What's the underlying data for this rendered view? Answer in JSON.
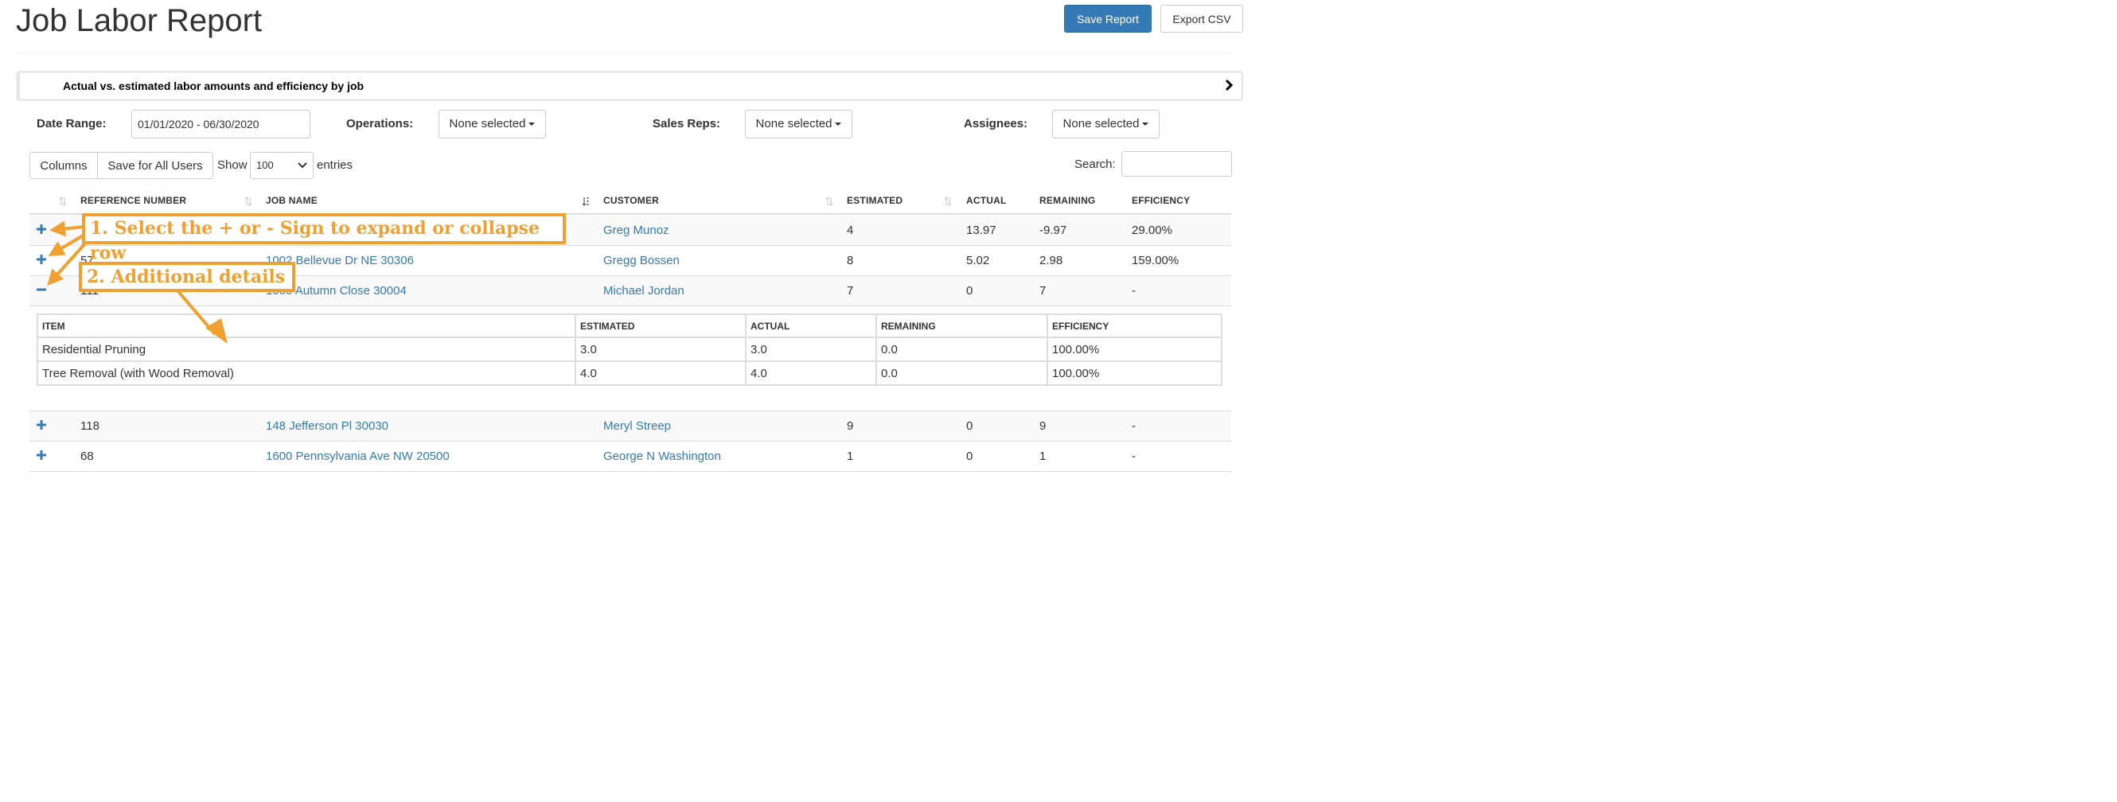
{
  "header": {
    "title": "Job Labor Report",
    "save_label": "Save Report",
    "export_label": "Export CSV"
  },
  "panel": {
    "title": "Actual vs. estimated labor amounts and efficiency by job"
  },
  "filters": {
    "date_range_label": "Date Range:",
    "date_range_value": "01/01/2020 - 06/30/2020",
    "operations_label": "Operations:",
    "operations_value": "None selected",
    "sales_reps_label": "Sales Reps:",
    "sales_reps_value": "None selected",
    "assignees_label": "Assignees:",
    "assignees_value": "None selected"
  },
  "toolbar": {
    "columns_label": "Columns",
    "save_all_label": "Save for All Users",
    "show_label": "Show",
    "entries_value": "100",
    "entries_label": "entries",
    "search_label": "Search:"
  },
  "table": {
    "columns": [
      "REFERENCE NUMBER",
      "JOB NAME",
      "CUSTOMER",
      "ESTIMATED",
      "ACTUAL",
      "REMAINING",
      "EFFICIENCY"
    ],
    "rows": [
      {
        "ref": "",
        "job": "",
        "customer": "Greg Munoz",
        "estimated": "4",
        "actual": "13.97",
        "remaining": "-9.97",
        "efficiency": "29.00%"
      },
      {
        "ref": "57",
        "job": "1002 Bellevue Dr NE 30306",
        "customer": "Gregg Bossen",
        "estimated": "8",
        "actual": "5.02",
        "remaining": "2.98",
        "efficiency": "159.00%"
      },
      {
        "ref": "111",
        "job": "1000 Autumn Close 30004",
        "customer": "Michael Jordan",
        "estimated": "7",
        "actual": "0",
        "remaining": "7",
        "efficiency": "-"
      },
      {
        "ref": "118",
        "job": "148 Jefferson Pl 30030",
        "customer": "Meryl Streep",
        "estimated": "9",
        "actual": "0",
        "remaining": "9",
        "efficiency": "-"
      },
      {
        "ref": "68",
        "job": "1600 Pennsylvania Ave NW 20500",
        "customer": "George N Washington",
        "estimated": "1",
        "actual": "0",
        "remaining": "1",
        "efficiency": "-"
      }
    ]
  },
  "details": {
    "columns": [
      "ITEM",
      "ESTIMATED",
      "ACTUAL",
      "REMAINING",
      "EFFICIENCY"
    ],
    "rows": [
      {
        "item": "Residential Pruning",
        "estimated": "3.0",
        "actual": "3.0",
        "remaining": "0.0",
        "efficiency": "100.00%"
      },
      {
        "item": "Tree Removal (with Wood Removal)",
        "estimated": "4.0",
        "actual": "4.0",
        "remaining": "0.0",
        "efficiency": "100.00%"
      }
    ]
  },
  "annotations": {
    "step1": "1. Select the + or - Sign to expand or collapse row",
    "step2": "2. Additional details",
    "color": "#f0a030"
  },
  "colors": {
    "link": "#337ab7",
    "primary": "#337ab7"
  }
}
